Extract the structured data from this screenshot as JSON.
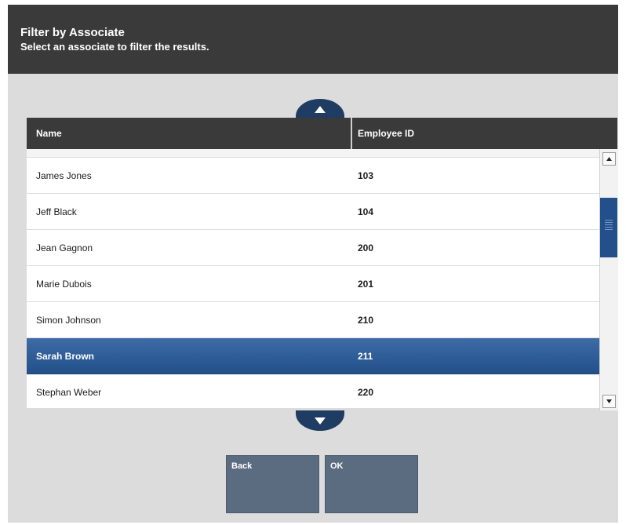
{
  "header": {
    "title": "Filter by Associate",
    "subtitle": "Select an associate to filter the results."
  },
  "table": {
    "columns": {
      "name": "Name",
      "employee_id": "Employee ID"
    },
    "rows": [
      {
        "name": "James Jones",
        "id": "103"
      },
      {
        "name": "Jeff Black",
        "id": "104"
      },
      {
        "name": "Jean Gagnon",
        "id": "200"
      },
      {
        "name": "Marie Dubois",
        "id": "201"
      },
      {
        "name": "Simon Johnson",
        "id": "210"
      },
      {
        "name": "Sarah Brown",
        "id": "211"
      },
      {
        "name": "Stephan Weber",
        "id": "220"
      }
    ],
    "selected_index": 5
  },
  "buttons": {
    "back": "Back",
    "ok": "OK"
  },
  "icons": {
    "page_up": "triangle-up-icon",
    "page_down": "triangle-down-icon",
    "scroll_up": "scroll-up-arrow-icon",
    "scroll_down": "scroll-down-arrow-icon"
  },
  "colors": {
    "header_bg": "#3a3a3a",
    "selected_row": "#2a5a94",
    "button_bg": "#5b6b80",
    "arrow_btn": "#1f3c62"
  }
}
